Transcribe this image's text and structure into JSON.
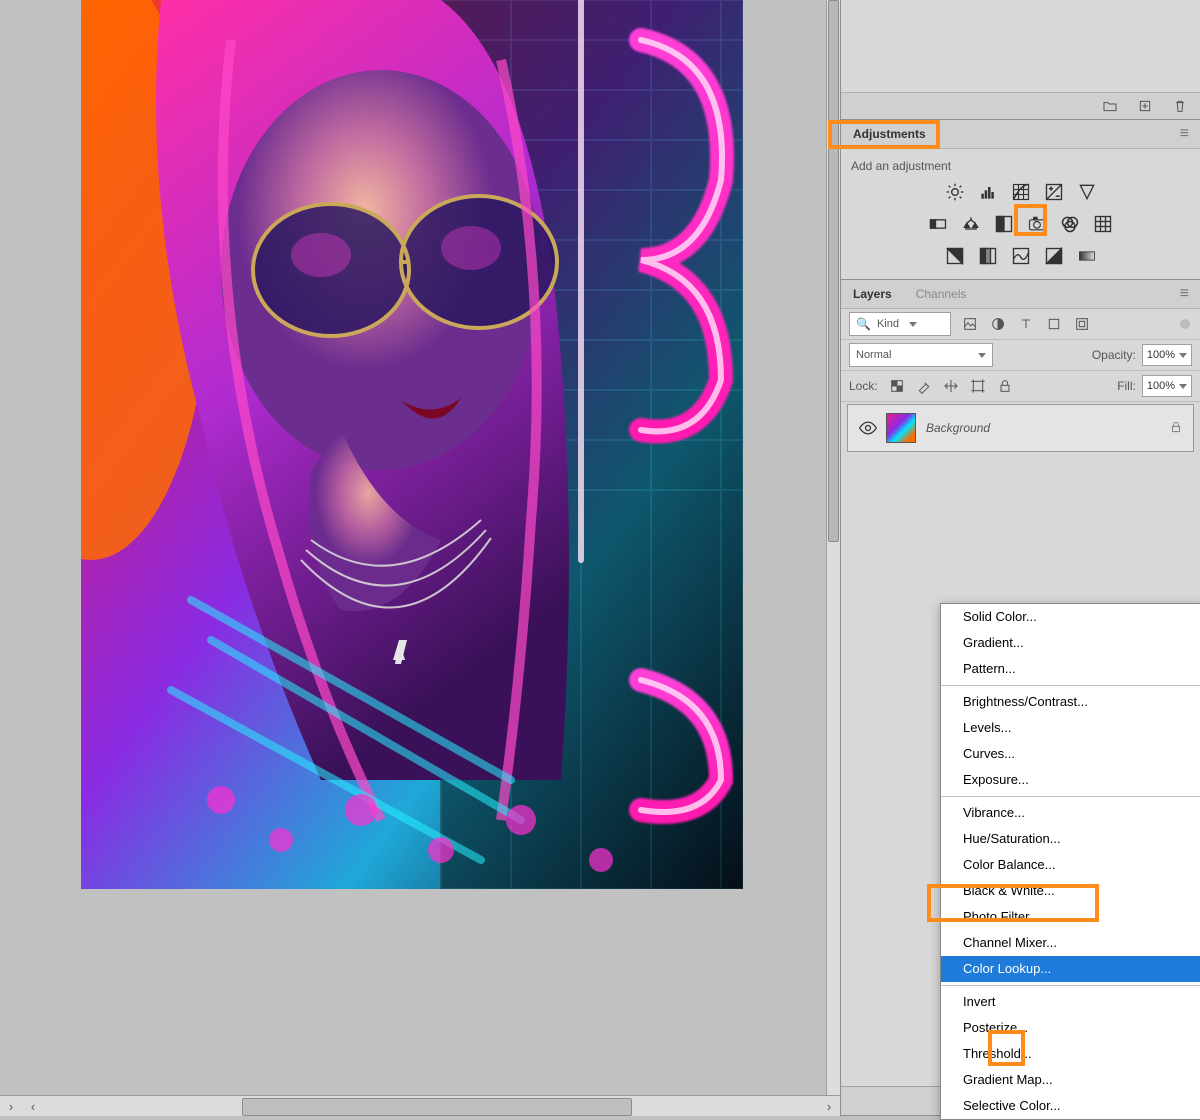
{
  "adjustments": {
    "tab_label": "Adjustments",
    "prompt": "Add an adjustment"
  },
  "panels": {
    "layers_tab": "Layers",
    "channels_tab": "Channels"
  },
  "filter": {
    "kind_label": "Kind"
  },
  "blend": {
    "mode": "Normal",
    "opacity_label": "Opacity:",
    "opacity_value": "100%"
  },
  "lock": {
    "label": "Lock:",
    "fill_label": "Fill:",
    "fill_value": "100%"
  },
  "layer": {
    "name": "Background"
  },
  "scroll": {
    "left": "‹",
    "right": "›"
  },
  "menu": {
    "items": [
      "Solid Color...",
      "Gradient...",
      "Pattern..."
    ],
    "group2": [
      "Brightness/Contrast...",
      "Levels...",
      "Curves...",
      "Exposure..."
    ],
    "group3": [
      "Vibrance...",
      "Hue/Saturation...",
      "Color Balance...",
      "Black & White...",
      "Photo Filter...",
      "Channel Mixer...",
      "Color Lookup..."
    ],
    "group4": [
      "Invert",
      "Posterize...",
      "Threshold...",
      "Gradient Map...",
      "Selective Color..."
    ],
    "highlighted": "Color Lookup..."
  }
}
